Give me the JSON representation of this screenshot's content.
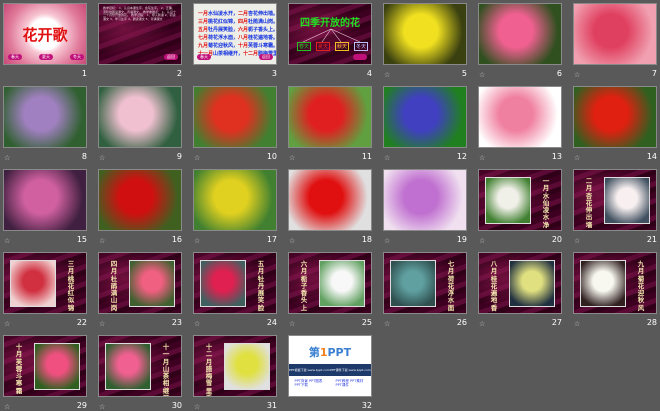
{
  "colors": {
    "background": "#595959",
    "slide_maroon": "#4a0a2a"
  },
  "star_icon": "☆",
  "slide1": {
    "title": "花开歌",
    "buttons": [
      "春天",
      "夏天",
      "冬天"
    ]
  },
  "slide2": {
    "text": "教学目标： 1、认识本课生字，会写生字。 2、正确、流利地朗读课文，背诵课文。 教学重难点： 1、认识十二个月份开放的花。 教学过程： 1、导入新课 2、初读课文 3、学习生字 4、朗读课文 5、背诵课文",
    "button": "返回"
  },
  "slide3": {
    "lines": [
      [
        "一月",
        "水仙凌水开，",
        "二月",
        "杏花伸出墙。"
      ],
      [
        "三月",
        "桃花红似锦，",
        "四月",
        "杜鹃满山岗。"
      ],
      [
        "五月",
        "牡丹展笑脸，",
        "六月",
        "栀子香头上。"
      ],
      [
        "七月",
        "荷花浮水面，",
        "八月",
        "桂花遍地香。"
      ],
      [
        "九月",
        "菊花迎秋风，",
        "十月",
        "芙蓉斗寒霜。"
      ],
      [
        "十一月",
        "山茶相继开，",
        "十二月",
        "腊梅雪里香。"
      ]
    ],
    "buttons": [
      "春天",
      "返回"
    ]
  },
  "slide4": {
    "title": "四季开放的花",
    "seasons": [
      "春天",
      "夏天",
      "秋天",
      "冬天"
    ],
    "season_colors": [
      "#20c020",
      "#e02020",
      "#f0c020",
      "#c0c0ff"
    ]
  },
  "slide32": {
    "logo_main": "第",
    "logo_num": "1",
    "logo_tail": "PPT",
    "band": [
      "PPT模板下载 www.1ppt.com",
      "PPT课件下载 www.1ppt.com"
    ],
    "links": [
      "PPT背景 PPT图表 PPT下载",
      "PPT教程 PPT素材 PPT课件"
    ]
  },
  "slides": [
    {
      "number": "1",
      "type": "title",
      "star": false
    },
    {
      "number": "2",
      "type": "text",
      "star": false
    },
    {
      "number": "3",
      "type": "poem",
      "star": false
    },
    {
      "number": "4",
      "type": "seasons",
      "star": false
    },
    {
      "number": "5",
      "type": "photo",
      "colors": [
        "#f0e020",
        "#3a4010"
      ],
      "star": true
    },
    {
      "number": "6",
      "type": "photo",
      "colors": [
        "#f06090",
        "#305020"
      ],
      "star": true
    },
    {
      "number": "7",
      "type": "photo",
      "colors": [
        "#e04060",
        "#f0a0b0"
      ],
      "star": true
    },
    {
      "number": "8",
      "type": "photo",
      "colors": [
        "#a080c0",
        "#306030"
      ],
      "star": true
    },
    {
      "number": "9",
      "type": "photo",
      "colors": [
        "#f0c0d0",
        "#306040"
      ],
      "star": true
    },
    {
      "number": "10",
      "type": "photo",
      "colors": [
        "#e03020",
        "#408030"
      ],
      "star": true
    },
    {
      "number": "11",
      "type": "photo",
      "colors": [
        "#e02020",
        "#60a040"
      ],
      "star": true
    },
    {
      "number": "12",
      "type": "photo",
      "colors": [
        "#4040c0",
        "#208020"
      ],
      "star": true
    },
    {
      "number": "13",
      "type": "photo",
      "colors": [
        "#f080a0",
        "#ffffff"
      ],
      "star": true
    },
    {
      "number": "14",
      "type": "photo",
      "colors": [
        "#e02010",
        "#306020"
      ],
      "star": true
    },
    {
      "number": "15",
      "type": "photo",
      "colors": [
        "#d060a0",
        "#402040"
      ],
      "star": true
    },
    {
      "number": "16",
      "type": "photo",
      "colors": [
        "#d01010",
        "#406020"
      ],
      "star": true
    },
    {
      "number": "17",
      "type": "photo",
      "colors": [
        "#e0d020",
        "#408030"
      ],
      "star": true
    },
    {
      "number": "18",
      "type": "photo",
      "colors": [
        "#e01010",
        "#e0e0e0"
      ],
      "star": true
    },
    {
      "number": "19",
      "type": "photo",
      "colors": [
        "#c070d0",
        "#f0e0f0"
      ],
      "star": true
    },
    {
      "number": "20",
      "type": "caption",
      "caption": "一月水仙凌水净",
      "caption_side": "right",
      "colors": [
        "#f0f0e8",
        "#408030"
      ],
      "star": true
    },
    {
      "number": "21",
      "type": "caption",
      "caption": "二月杏花伸出墙",
      "caption_side": "left",
      "colors": [
        "#f8f0f0",
        "#405060"
      ],
      "star": true
    },
    {
      "number": "22",
      "type": "caption",
      "caption": "三月桃花红似锦",
      "caption_side": "right",
      "colors": [
        "#d03040",
        "#f0d0d0"
      ],
      "star": true
    },
    {
      "number": "23",
      "type": "caption",
      "caption": "四月杜鹃满山岗",
      "caption_side": "left",
      "colors": [
        "#f06080",
        "#406030"
      ],
      "star": true
    },
    {
      "number": "24",
      "type": "caption",
      "caption": "五月牡丹展笑脸",
      "caption_side": "right",
      "colors": [
        "#e02050",
        "#406060"
      ],
      "star": true
    },
    {
      "number": "25",
      "type": "caption",
      "caption": "六月栀子香头上",
      "caption_side": "left",
      "colors": [
        "#f8f8f8",
        "#60a060"
      ],
      "star": true
    },
    {
      "number": "26",
      "type": "caption",
      "caption": "七月荷花浮水面",
      "caption_side": "right",
      "colors": [
        "#60a0a0",
        "#305050"
      ],
      "star": true
    },
    {
      "number": "27",
      "type": "caption",
      "caption": "八月桂花遍地香",
      "caption_side": "left",
      "colors": [
        "#e0e080",
        "#203040"
      ],
      "star": true
    },
    {
      "number": "28",
      "type": "caption",
      "caption": "九月菊花迎秋风",
      "caption_side": "right",
      "colors": [
        "#f8f8f0",
        "#302020"
      ],
      "star": true
    },
    {
      "number": "29",
      "type": "caption",
      "caption": "十月芙蓉斗寒霜",
      "caption_side": "left",
      "colors": [
        "#f05080",
        "#306020"
      ],
      "star": true
    },
    {
      "number": "30",
      "type": "caption",
      "caption": "十一月山茶相继开",
      "caption_side": "right",
      "colors": [
        "#f06090",
        "#306030"
      ],
      "star": true
    },
    {
      "number": "31",
      "type": "caption",
      "caption": "十二月腊梅雪里香",
      "caption_side": "left",
      "colors": [
        "#e0e040",
        "#e0e0e0"
      ],
      "star": true
    },
    {
      "number": "32",
      "type": "ad",
      "star": false
    }
  ]
}
